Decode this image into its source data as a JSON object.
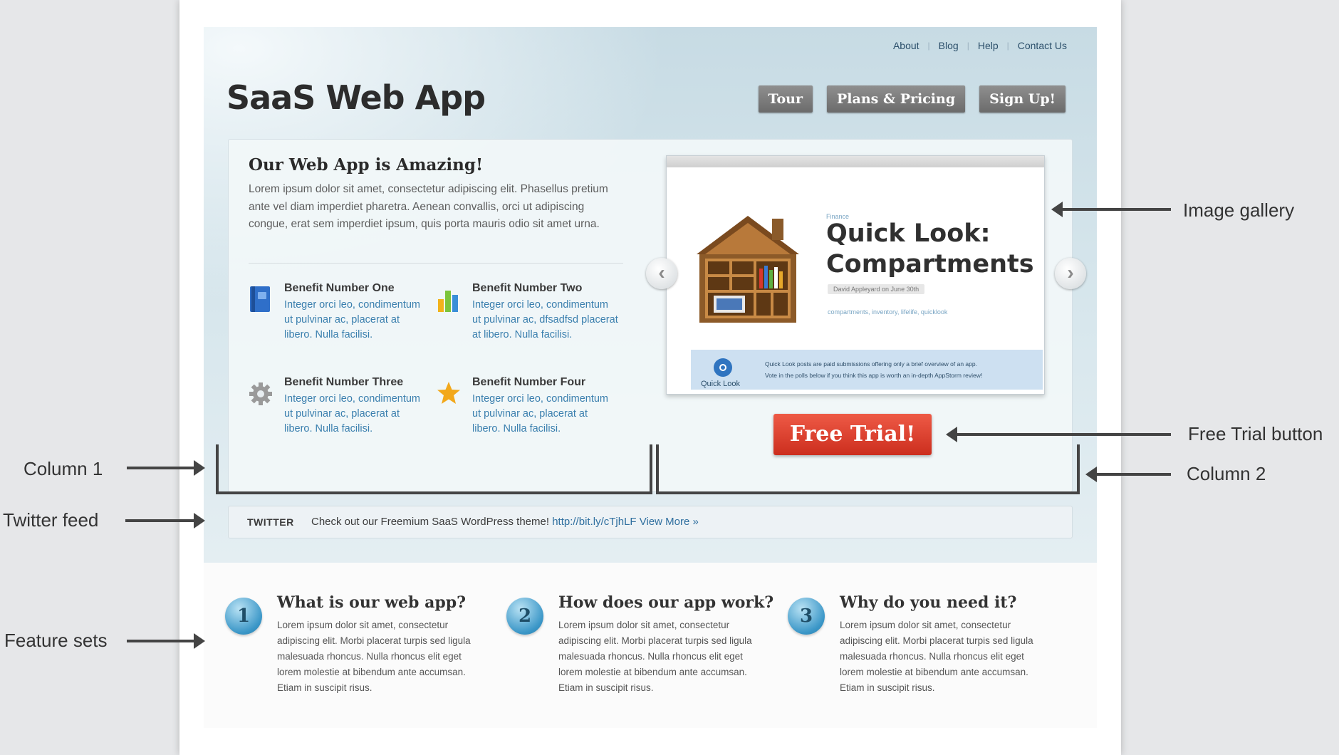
{
  "site": {
    "logo": "SaaS Web App",
    "top_nav": [
      {
        "label": "About"
      },
      {
        "label": "Blog"
      },
      {
        "label": "Help"
      },
      {
        "label": "Contact Us"
      }
    ],
    "main_nav": [
      {
        "label": "Tour"
      },
      {
        "label": "Plans & Pricing"
      },
      {
        "label": "Sign Up!"
      }
    ],
    "intro": {
      "title": "Our Web App is Amazing!",
      "text": "Lorem ipsum dolor sit amet, consectetur adipiscing elit. Phasellus pretium ante vel diam imperdiet pharetra. Aenean convallis, orci ut adipiscing congue, erat sem imperdiet ipsum, quis porta mauris odio sit amet urna."
    },
    "benefits": [
      {
        "title": "Benefit Number One",
        "text": "Integer orci leo, condimentum ut pulvinar ac, placerat at libero. Nulla facilisi.",
        "icon": "book-icon"
      },
      {
        "title": "Benefit Number Two",
        "text": "Integer orci leo, condimentum ut pulvinar ac, dfsadfsd placerat at libero. Nulla facilisi.",
        "icon": "bar-chart-icon"
      },
      {
        "title": "Benefit Number Three",
        "text": "Integer orci leo, condimentum ut pulvinar ac, placerat at libero. Nulla facilisi.",
        "icon": "gear-icon"
      },
      {
        "title": "Benefit Number Four",
        "text": "Integer orci leo, condimentum ut pulvinar ac, placerat at libero. Nulla facilisi.",
        "icon": "star-icon"
      }
    ],
    "gallery": {
      "category": "Finance",
      "title_line1": "Quick Look:",
      "title_line2": "Compartments",
      "meta": "David Appleyard on June 30th",
      "tags": "compartments, inventory, lifelife, quicklook",
      "strip_label": "Quick Look",
      "strip_text_line1": "Quick Look posts are paid submissions offering only a brief overview of an app.",
      "strip_text_line2": "Vote in the polls below if you think this app is worth an in-depth AppStorm review!",
      "prev_glyph": "‹",
      "next_glyph": "›"
    },
    "cta": {
      "label": "Free Trial!"
    },
    "twitter": {
      "label": "TWITTER",
      "text": "Check out our Freemium SaaS WordPress theme!",
      "link": "http://bit.ly/cTjhLF",
      "more": "View More »"
    },
    "features": [
      {
        "number": "1",
        "title": "What is our web app?",
        "text": "Lorem ipsum dolor sit amet, consectetur adipiscing elit. Morbi placerat turpis sed ligula malesuada rhoncus. Nulla rhoncus elit eget lorem molestie at bibendum ante accumsan. Etiam in suscipit risus."
      },
      {
        "number": "2",
        "title": "How does our app work?",
        "text": "Lorem ipsum dolor sit amet, consectetur adipiscing elit. Morbi placerat turpis sed ligula malesuada rhoncus. Nulla rhoncus elit eget lorem molestie at bibendum ante accumsan. Etiam in suscipit risus."
      },
      {
        "number": "3",
        "title": "Why do you need it?",
        "text": "Lorem ipsum dolor sit amet, consectetur adipiscing elit. Morbi placerat turpis sed ligula malesuada rhoncus. Nulla rhoncus elit eget lorem molestie at bibendum ante accumsan. Etiam in suscipit risus."
      }
    ]
  },
  "annotations": {
    "image_gallery": "Image gallery",
    "free_trial_button": "Free Trial button",
    "column_1": "Column 1",
    "column_2": "Column 2",
    "twitter_feed": "Twitter feed",
    "feature_sets": "Feature sets"
  },
  "colors": {
    "cta": "#d9382a",
    "link": "#3a7fae",
    "nav_button": "#7a7a7a",
    "hero_bg": "#cfe0e8"
  }
}
